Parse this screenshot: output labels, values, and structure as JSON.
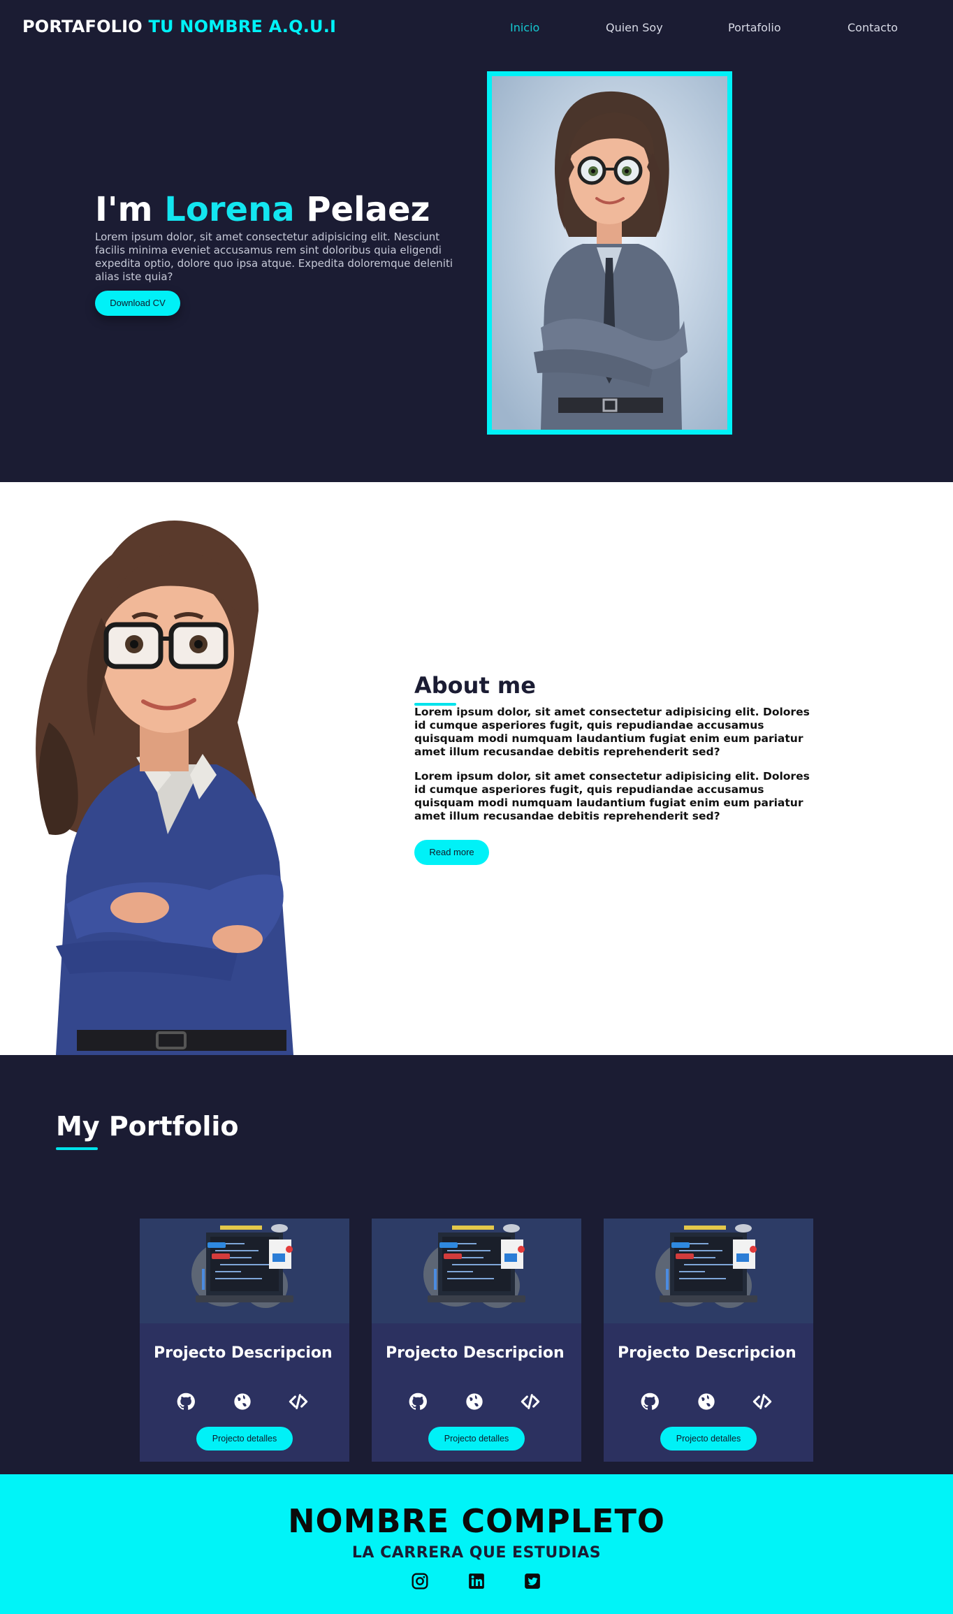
{
  "nav": {
    "brand_main": "PORTAFOLIO",
    "brand_accent": "TU NOMBRE A.Q.U.I",
    "links": [
      "Inicio",
      "Quien Soy",
      "Portafolio",
      "Contacto"
    ],
    "active": "Inicio"
  },
  "hero": {
    "greeting": "I'm",
    "first_name": "Lorena",
    "last_name": "Pelaez",
    "text": "Lorem ipsum dolor, sit amet consectetur adipisicing elit. Nesciunt facilis minima eveniet accusamus rem sint doloribus quia eligendi expedita optio, dolore quo ipsa atque. Expedita doloremque deleniti alias iste quia?",
    "button": "Download CV"
  },
  "about": {
    "title": "About me",
    "paragraphs": [
      "Lorem ipsum dolor, sit amet consectetur adipisicing elit. Dolores id cumque asperiores fugit, quis repudiandae accusamus quisquam modi numquam laudantium fugiat enim eum pariatur amet illum recusandae debitis reprehenderit sed?",
      "Lorem ipsum dolor, sit amet consectetur adipisicing elit. Dolores id cumque asperiores fugit, quis repudiandae accusamus quisquam modi numquam laudantium fugiat enim eum pariatur amet illum recusandae debitis reprehenderit sed?"
    ],
    "button": "Read more"
  },
  "portfolio": {
    "title": "My Portfolio",
    "cards": [
      {
        "title": "Projecto Descripcion",
        "button": "Projecto detalles",
        "icons": [
          "github-icon",
          "globe-icon",
          "code-icon"
        ]
      },
      {
        "title": "Projecto Descripcion",
        "button": "Projecto detalles",
        "icons": [
          "github-icon",
          "globe-icon",
          "code-icon"
        ]
      },
      {
        "title": "Projecto Descripcion",
        "button": "Projecto detalles",
        "icons": [
          "github-icon",
          "globe-icon",
          "code-icon"
        ]
      }
    ]
  },
  "footer": {
    "name": "NOMBRE COMPLETO",
    "career": "LA CARRERA QUE ESTUDIAS",
    "social_icons": [
      "instagram-icon",
      "linkedin-icon",
      "twitter-icon"
    ]
  },
  "colors": {
    "background": "#1b1c33",
    "accent": "#00f1f7",
    "card": "#2c3160",
    "white": "#ffffff"
  }
}
